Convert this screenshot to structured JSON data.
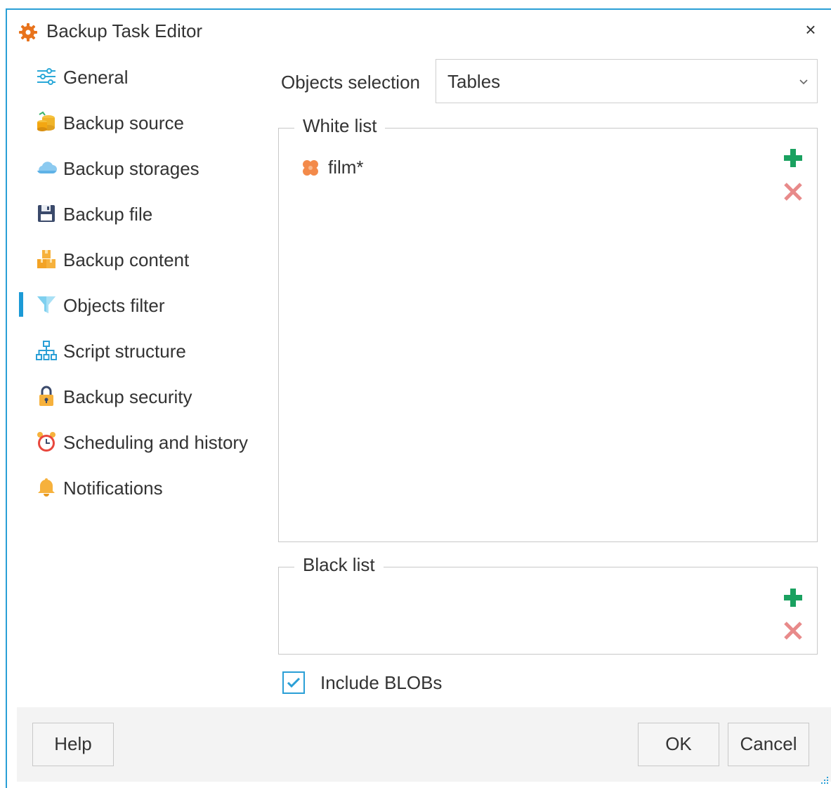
{
  "window": {
    "title": "Backup Task Editor",
    "close_glyph": "×",
    "accent_color": "#2a9fd6"
  },
  "sidebar": {
    "selected_index": 5,
    "items": [
      {
        "label": "General",
        "icon": "sliders-icon"
      },
      {
        "label": "Backup source",
        "icon": "database-coins-icon"
      },
      {
        "label": "Backup storages",
        "icon": "cloud-icon"
      },
      {
        "label": "Backup file",
        "icon": "floppy-disk-icon"
      },
      {
        "label": "Backup content",
        "icon": "boxes-icon"
      },
      {
        "label": "Objects filter",
        "icon": "funnel-icon"
      },
      {
        "label": "Script structure",
        "icon": "hierarchy-icon"
      },
      {
        "label": "Backup security",
        "icon": "padlock-icon"
      },
      {
        "label": "Scheduling and history",
        "icon": "alarm-clock-icon"
      },
      {
        "label": "Notifications",
        "icon": "bell-icon"
      }
    ]
  },
  "objects_selection": {
    "label": "Objects selection",
    "value": "Tables"
  },
  "white_list": {
    "legend": "White list",
    "items": [
      {
        "name": "film*",
        "icon": "puzzle-piece-icon"
      }
    ]
  },
  "black_list": {
    "legend": "Black list",
    "items": []
  },
  "include_blobs": {
    "label": "Include BLOBs",
    "checked": true
  },
  "footer": {
    "help_label": "Help",
    "ok_label": "OK",
    "cancel_label": "Cancel"
  },
  "colors": {
    "add": "#1aa160",
    "remove": "#e88a8a",
    "selection_bar": "#1c9ad6"
  }
}
